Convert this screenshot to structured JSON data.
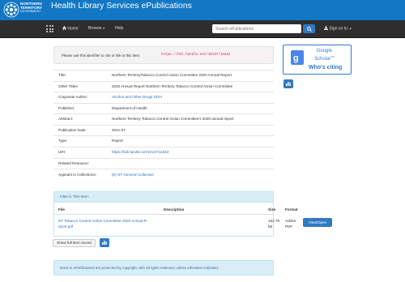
{
  "header": {
    "logo_line1": "NORTHERN",
    "logo_line2": "TERRITORY",
    "logo_line3": "GOVERNMENT",
    "title": "Health Library Services ePublications"
  },
  "nav": {
    "home": "Home",
    "browse": "Browse",
    "help": "Help",
    "search_placeholder": "Search ePublications",
    "signin": "Sign on to:"
  },
  "identifier": {
    "label": "Please use this identifier to cite or link to this item:",
    "url": "https://hdl.handle.net/10137/11832"
  },
  "metadata": [
    {
      "key": "Title:",
      "value": "Northern TerritoryTobacco Control Action Committee 2020 Annual Report",
      "link": false
    },
    {
      "key": "Other Titles:",
      "value": "2020 Annual Report Northern Territory Tobacco Control Action Committee",
      "link": false
    },
    {
      "key": "Corporate Author:",
      "value": "Alcohol and Other Drugs DOH",
      "link": true
    },
    {
      "key": "Publisher:",
      "value": "Department of Health",
      "link": false
    },
    {
      "key": "Abstract:",
      "value": "Northern Territory Tobacco Control Action Committee's 2020 annual report.",
      "link": false
    },
    {
      "key": "Publication Date:",
      "value": "2021-07",
      "link": false
    },
    {
      "key": "Type:",
      "value": "Report",
      "link": false
    },
    {
      "key": "URI:",
      "value": "https://hdl.handle.net/10137/11832",
      "link": true
    },
    {
      "key": "Related Resource:",
      "value": "",
      "link": false
    },
    {
      "key": "Appears in Collections:",
      "value": "(b) NT General Collection",
      "link": true
    }
  ],
  "files": {
    "panel_title": "Files in This Item:",
    "headers": {
      "file": "File",
      "description": "Description",
      "size": "Size",
      "format": "Format"
    },
    "rows": [
      {
        "file_line1": "NT Tobacco Control Action Committee 2020 Annual R",
        "file_line2": "eport.pdf",
        "size_line1": "182.76",
        "size_line2": "kB",
        "format_line1": "Adobe",
        "format_line2": "PDF",
        "action": "View/Open"
      }
    ]
  },
  "buttons": {
    "show_full": "Show full item record"
  },
  "notice": "Items in ePublications are protected by copyright, with all rights reserved, unless otherwise indicated.",
  "scholar": {
    "line1": "Google",
    "line2": "Scholar",
    "tm": "TM",
    "cite": "Who's citing"
  },
  "colors": {
    "brand_blue": "#1277c4",
    "navbar": "#2e2e2e",
    "link": "#2f6fb3",
    "button": "#3179c2"
  },
  "icons": {
    "home": "home-icon",
    "search": "search-icon",
    "user": "user-icon",
    "stats": "bar-chart-icon",
    "apps": "grid-icon"
  }
}
